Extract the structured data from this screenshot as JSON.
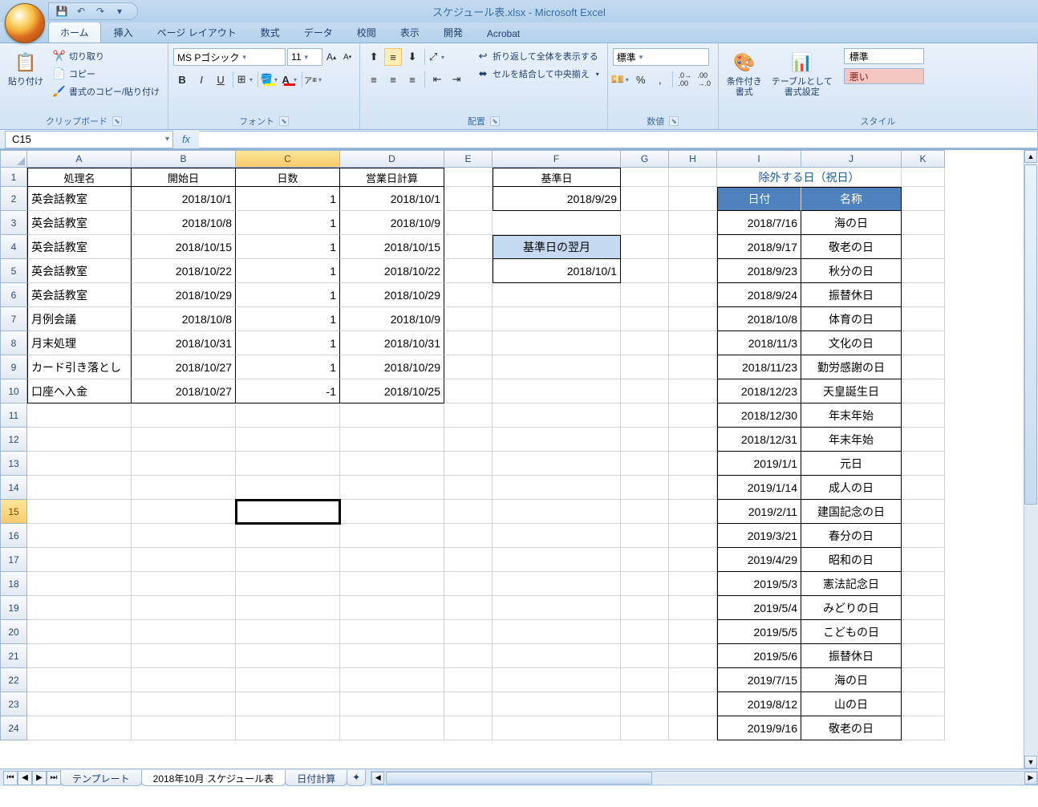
{
  "window_title": "スケジュール表.xlsx - Microsoft Excel",
  "qat": {
    "save": "💾",
    "undo": "↶",
    "redo": "↷",
    "more": "▾"
  },
  "tabs": [
    "ホーム",
    "挿入",
    "ページ レイアウト",
    "数式",
    "データ",
    "校閲",
    "表示",
    "開発",
    "Acrobat"
  ],
  "active_tab": 0,
  "clipboard": {
    "paste": "貼り付け",
    "cut": "切り取り",
    "copy": "コピー",
    "format_painter": "書式のコピー/貼り付け",
    "group_label": "クリップボード"
  },
  "font": {
    "family": "MS Pゴシック",
    "size": "11",
    "group_label": "フォント"
  },
  "alignment": {
    "wrap": "折り返して全体を表示する",
    "merge": "セルを結合して中央揃え",
    "group_label": "配置"
  },
  "number": {
    "format": "標準",
    "group_label": "数値"
  },
  "styles_group": {
    "conditional": "条件付き\n書式",
    "table_format": "テーブルとして\n書式設定",
    "style_normal": "標準",
    "style_bad": "悪い",
    "group_label": "スタイル"
  },
  "name_box": "C15",
  "formula_bar": "",
  "columns": [
    "A",
    "B",
    "C",
    "D",
    "E",
    "F",
    "G",
    "H",
    "I",
    "J",
    "K"
  ],
  "row_headers": [
    1,
    2,
    3,
    4,
    5,
    6,
    7,
    8,
    9,
    10,
    11,
    12,
    13,
    14,
    15,
    16,
    17,
    18,
    19,
    20,
    21,
    22,
    23,
    24
  ],
  "selected_cell": {
    "row": 15,
    "col": "C"
  },
  "main_headers": {
    "A1": "処理名",
    "B1": "開始日",
    "C1": "日数",
    "D1": "営業日計算"
  },
  "ref_headers": {
    "F1": "基準日",
    "F4": "基準日の翌月"
  },
  "ref_values": {
    "F2": "2018/9/29",
    "F5": "2018/10/1"
  },
  "holiday_title": "除外する日（祝日）",
  "holiday_headers": {
    "I2": "日付",
    "J2": "名称"
  },
  "main_rows": [
    {
      "name": "英会話教室",
      "start": "2018/10/1",
      "days": "1",
      "calc": "2018/10/1"
    },
    {
      "name": "英会話教室",
      "start": "2018/10/8",
      "days": "1",
      "calc": "2018/10/9"
    },
    {
      "name": "英会話教室",
      "start": "2018/10/15",
      "days": "1",
      "calc": "2018/10/15"
    },
    {
      "name": "英会話教室",
      "start": "2018/10/22",
      "days": "1",
      "calc": "2018/10/22"
    },
    {
      "name": "英会話教室",
      "start": "2018/10/29",
      "days": "1",
      "calc": "2018/10/29"
    },
    {
      "name": "月例会議",
      "start": "2018/10/8",
      "days": "1",
      "calc": "2018/10/9"
    },
    {
      "name": "月末処理",
      "start": "2018/10/31",
      "days": "1",
      "calc": "2018/10/31"
    },
    {
      "name": "カード引き落とし",
      "start": "2018/10/27",
      "days": "1",
      "calc": "2018/10/29"
    },
    {
      "name": "口座へ入金",
      "start": "2018/10/27",
      "days": "-1",
      "calc": "2018/10/25"
    }
  ],
  "holidays": [
    {
      "date": "2018/7/16",
      "name": "海の日"
    },
    {
      "date": "2018/9/17",
      "name": "敬老の日"
    },
    {
      "date": "2018/9/23",
      "name": "秋分の日"
    },
    {
      "date": "2018/9/24",
      "name": "振替休日"
    },
    {
      "date": "2018/10/8",
      "name": "体育の日"
    },
    {
      "date": "2018/11/3",
      "name": "文化の日"
    },
    {
      "date": "2018/11/23",
      "name": "勤労感謝の日"
    },
    {
      "date": "2018/12/23",
      "name": "天皇誕生日"
    },
    {
      "date": "2018/12/30",
      "name": "年末年始"
    },
    {
      "date": "2018/12/31",
      "name": "年末年始"
    },
    {
      "date": "2019/1/1",
      "name": "元日"
    },
    {
      "date": "2019/1/14",
      "name": "成人の日"
    },
    {
      "date": "2019/2/11",
      "name": "建国記念の日"
    },
    {
      "date": "2019/3/21",
      "name": "春分の日"
    },
    {
      "date": "2019/4/29",
      "name": "昭和の日"
    },
    {
      "date": "2019/5/3",
      "name": "憲法記念日"
    },
    {
      "date": "2019/5/4",
      "name": "みどりの日"
    },
    {
      "date": "2019/5/5",
      "name": "こどもの日"
    },
    {
      "date": "2019/5/6",
      "name": "振替休日"
    },
    {
      "date": "2019/7/15",
      "name": "海の日"
    },
    {
      "date": "2019/8/12",
      "name": "山の日"
    },
    {
      "date": "2019/9/16",
      "name": "敬老の日"
    }
  ],
  "sheet_tabs": [
    "テンプレート",
    "2018年10月 スケジュール表",
    "日付計算"
  ],
  "active_sheet_tab": 1
}
